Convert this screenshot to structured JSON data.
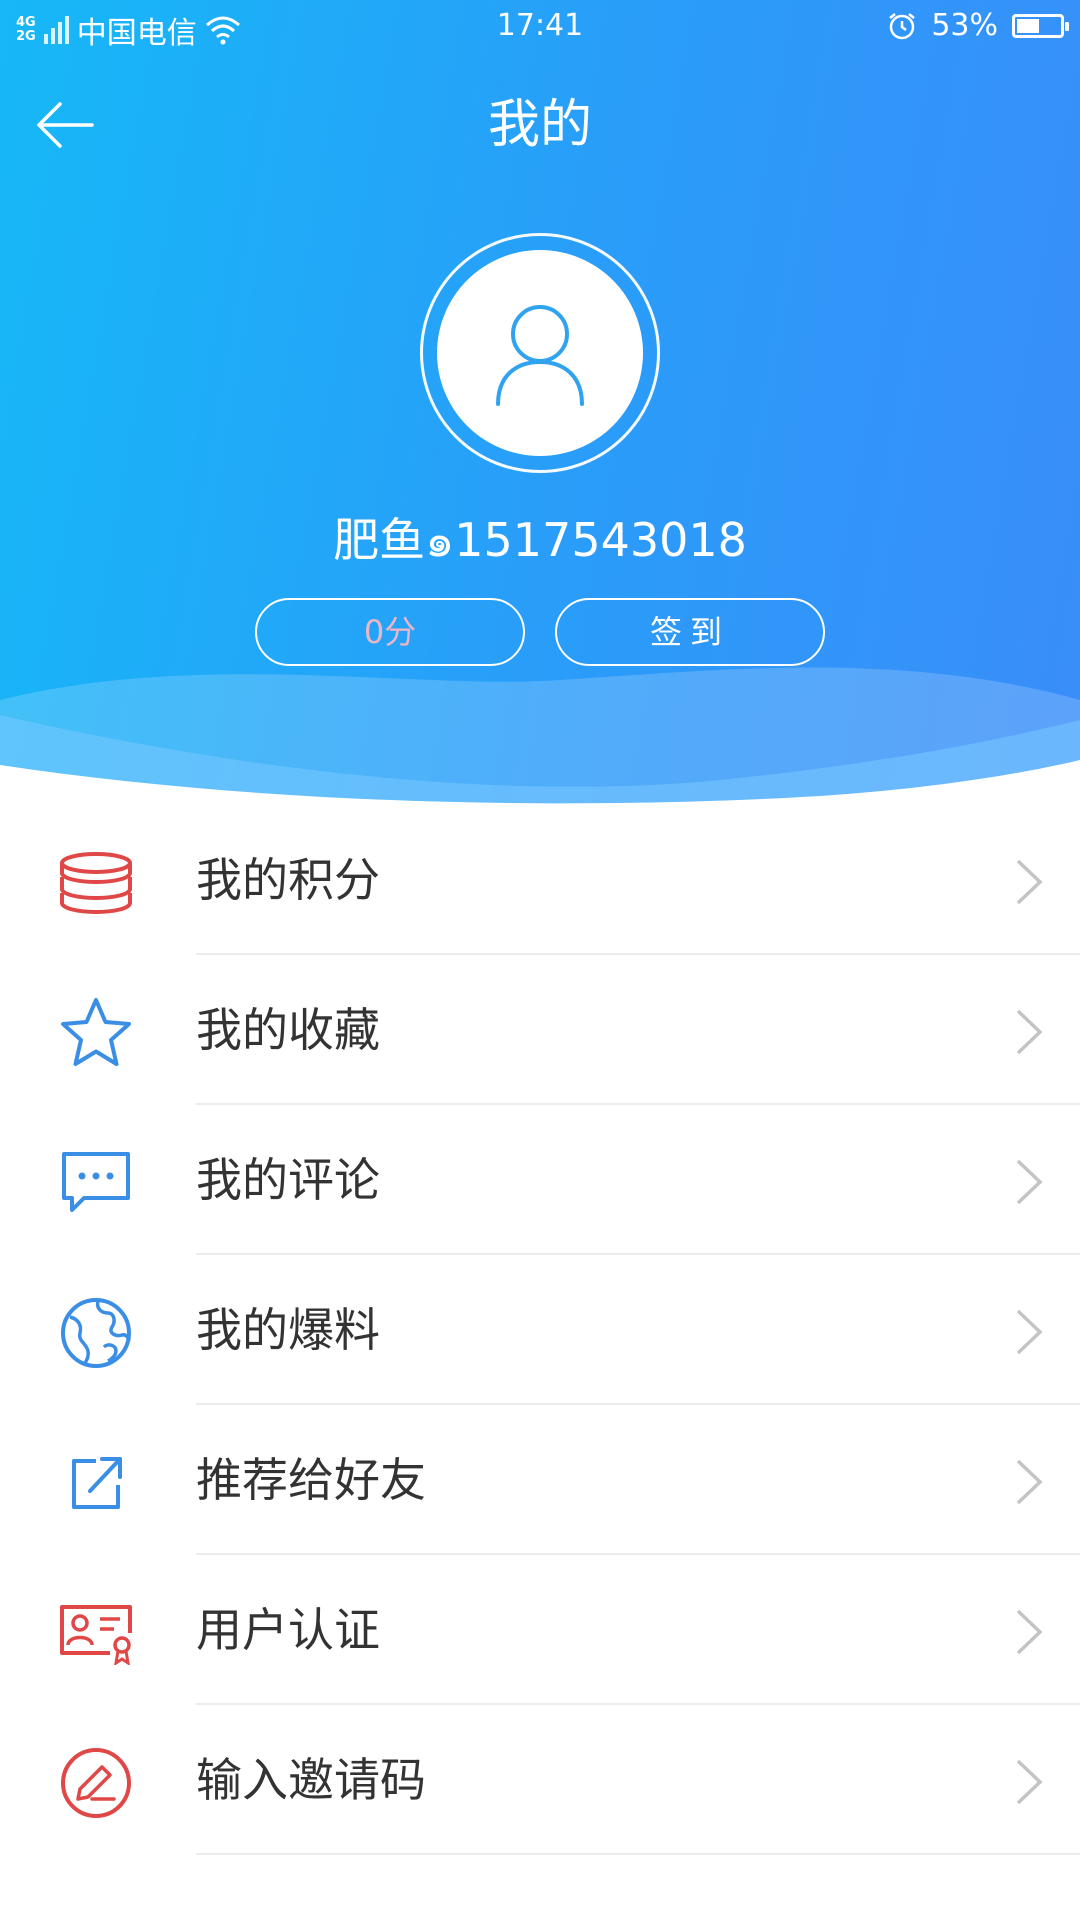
{
  "status_bar": {
    "network_top": "4G",
    "network_bottom": "2G",
    "carrier": "中国电信",
    "time": "17:41",
    "battery_percent": "53%",
    "battery_level": 0.53
  },
  "header": {
    "title": "我的"
  },
  "profile": {
    "username": "肥鱼๑1517543018",
    "points_label": "0分",
    "checkin_label": "签到"
  },
  "menu": {
    "items": [
      {
        "label": "我的积分",
        "icon": "coin-stack-icon",
        "color": "#e04747"
      },
      {
        "label": "我的收藏",
        "icon": "star-icon",
        "color": "#3a8ee6"
      },
      {
        "label": "我的评论",
        "icon": "comment-icon",
        "color": "#3a8ee6"
      },
      {
        "label": "我的爆料",
        "icon": "globe-icon",
        "color": "#3a8ee6"
      },
      {
        "label": "推荐给好友",
        "icon": "share-icon",
        "color": "#3a8ee6"
      },
      {
        "label": "用户认证",
        "icon": "certificate-icon",
        "color": "#e04747"
      },
      {
        "label": "输入邀请码",
        "icon": "edit-icon",
        "color": "#e04747"
      }
    ]
  },
  "colors": {
    "header_gradient_start": "#16b8f7",
    "header_gradient_end": "#3a8df9",
    "text_primary": "#333333",
    "chevron": "#c4c4c4",
    "divider": "#ececec"
  }
}
